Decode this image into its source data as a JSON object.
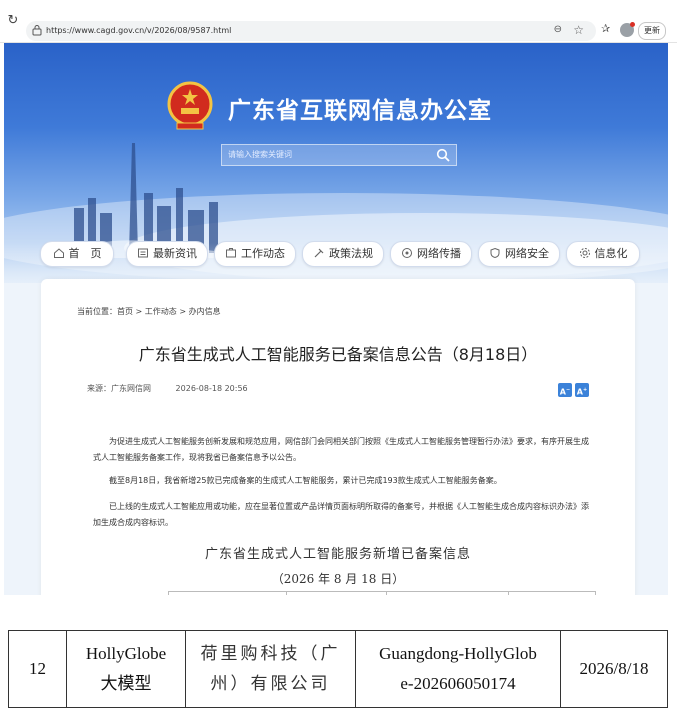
{
  "browser": {
    "url": "https://www.cagd.gov.cn/v/2026/08/9587.html",
    "update_label": "更新",
    "icons": [
      "reload-icon",
      "lock-icon",
      "zoom-icon",
      "star-icon",
      "favorites-icon",
      "profile-icon"
    ]
  },
  "site": {
    "title": "广东省互联网信息办公室",
    "search_placeholder": "请输入搜索关键词",
    "emblem": "national-emblem"
  },
  "nav": {
    "items": [
      {
        "label": "首　页",
        "icon": "home-icon"
      },
      {
        "label": "最新资讯",
        "icon": "news-icon"
      },
      {
        "label": "工作动态",
        "icon": "work-icon"
      },
      {
        "label": "政策法规",
        "icon": "policy-icon"
      },
      {
        "label": "网络传播",
        "icon": "broadcast-icon"
      },
      {
        "label": "网络安全",
        "icon": "shield-icon"
      },
      {
        "label": "信息化",
        "icon": "gear-icon"
      }
    ]
  },
  "breadcrumb": {
    "prefix": "当前位置：",
    "items": [
      "首页",
      "工作动态",
      "办内信息"
    ],
    "separator": " > "
  },
  "article": {
    "title": "广东省生成式人工智能服务已备案信息公告（8月18日）",
    "source": "来源：广东网信网",
    "date": "2026-08-18 20:56",
    "font_increase": "A",
    "font_decrease": "A",
    "paragraphs": [
      "为促进生成式人工智能服务创新发展和规范应用，网信部门会同相关部门按照《生成式人工智能服务管理暂行办法》要求，有序开展生成式人工智能服务备案工作，现将我省已备案信息予以公告。",
      "截至8月18日，我省新增25款已完成备案的生成式人工智能服务，累计已完成193款生成式人工智能服务备案。",
      "已上线的生成式人工智能应用或功能，应在显著位置或产品详情页面标明所取得的备案号，并根据《人工智能生成合成内容标识办法》添加生成合成内容标识。"
    ],
    "table_heading": "广东省生成式人工智能服务新增已备案信息",
    "table_date": "（2026 年 8 月 18 日）"
  },
  "table_row": {
    "index": "12",
    "model_name_line1": "HollyGlobe",
    "model_name_line2": "大模型",
    "company_line1": "荷里购科技（广",
    "company_line2": "州）有限公司",
    "filing_no_line1": "Guangdong-HollyGlob",
    "filing_no_line2": "e-202606050174",
    "date": "2026/8/18"
  },
  "colors": {
    "banner_top": "#2a62c8",
    "accent_button": "#3b82d9"
  }
}
